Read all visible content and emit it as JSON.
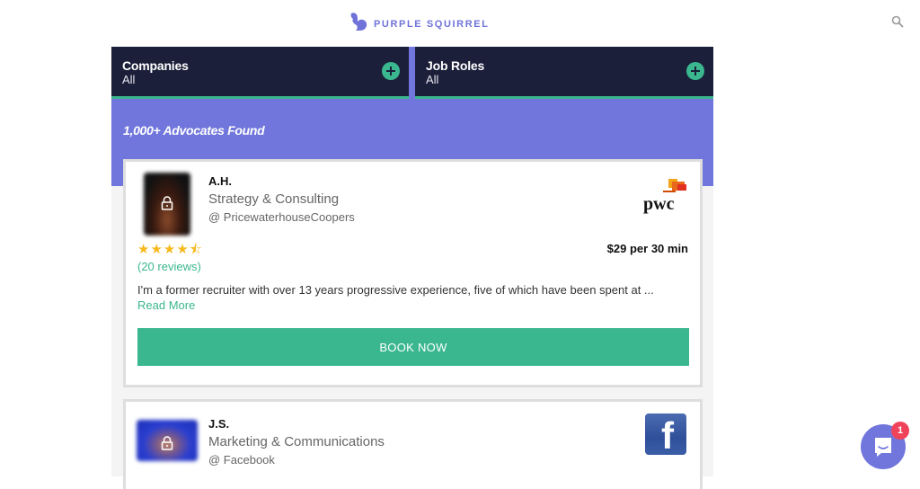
{
  "header": {
    "brand": "PURPLE SQUIRREL",
    "search_icon": "search-icon",
    "colors": {
      "brand": "#6f73d9"
    }
  },
  "filters": [
    {
      "title": "Companies",
      "value": "All",
      "icon": "plus-circle-icon"
    },
    {
      "title": "Job Roles",
      "value": "All",
      "icon": "plus-circle-icon"
    }
  ],
  "results": {
    "count_label": "1,000+ Advocates Found"
  },
  "advocates": [
    {
      "name": "A.H.",
      "role": "Strategy & Consulting",
      "company": "@ PricewaterhouseCoopers",
      "company_logo": "pwc",
      "rating": 4.5,
      "stars": "★★★★⯪",
      "reviews": "(20 reviews)",
      "price": "$29 per 30 min",
      "bio": "I'm a former recruiter with over 13 years progressive experience, five of which have been spent at ...",
      "read_more": "Read More",
      "book_label": "BOOK NOW"
    },
    {
      "name": "J.S.",
      "role": "Marketing & Communications",
      "company": "@ Facebook",
      "company_logo": "f"
    }
  ],
  "chat": {
    "badge_count": "1",
    "icon": "chat-bubble-icon"
  },
  "theme": {
    "navy": "#1c1f3a",
    "purple": "#7076db",
    "green": "#3bb78f",
    "star": "#f8b91c",
    "badge": "#f0435a"
  }
}
